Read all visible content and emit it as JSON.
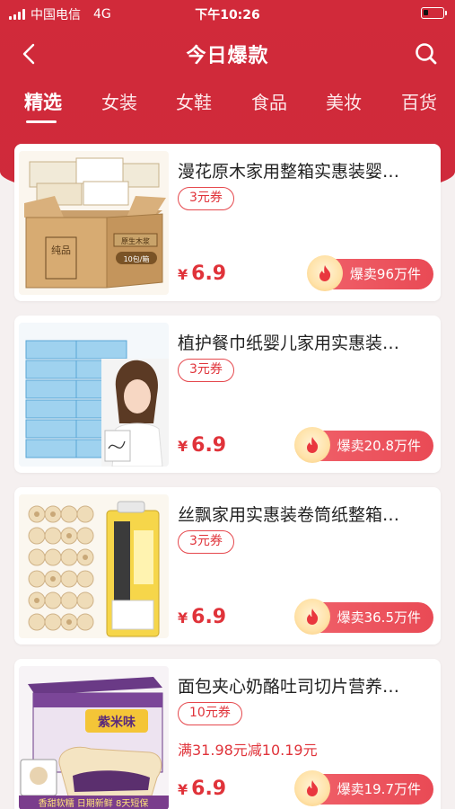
{
  "status_bar": {
    "carrier": "中国电信",
    "network": "4G",
    "time": "下午10:26"
  },
  "nav": {
    "title": "今日爆款"
  },
  "tabs": [
    {
      "label": "精选",
      "active": true
    },
    {
      "label": "女装"
    },
    {
      "label": "女鞋"
    },
    {
      "label": "食品"
    },
    {
      "label": "美妆"
    },
    {
      "label": "百货"
    }
  ],
  "products": [
    {
      "title": "漫花原木家用整箱实惠装婴…",
      "coupon": "3元券",
      "promo": "",
      "currency": "¥",
      "price": "6.9",
      "sold": "爆卖96万件"
    },
    {
      "title": "植护餐巾纸婴儿家用实惠装…",
      "coupon": "3元券",
      "promo": "",
      "currency": "¥",
      "price": "6.9",
      "sold": "爆卖20.8万件"
    },
    {
      "title": "丝飘家用实惠装卷筒纸整箱…",
      "coupon": "3元券",
      "promo": "",
      "currency": "¥",
      "price": "6.9",
      "sold": "爆卖36.5万件"
    },
    {
      "title": "面包夹心奶酪吐司切片营养…",
      "coupon": "10元券",
      "promo": "满31.98元减10.19元",
      "currency": "¥",
      "price": "6.9",
      "sold": "爆卖19.7万件"
    }
  ],
  "image_text": {
    "box_brand": "纯品",
    "box_label": "原生木浆",
    "box_count": "10包/箱",
    "bread_brand": "紫米味",
    "bread_banner": "香甜软糯 日期新鲜 8天短保"
  },
  "colors": {
    "brand_red": "#d12a3a",
    "price_red": "#e0333a",
    "sold_pill": "#ec5560"
  }
}
